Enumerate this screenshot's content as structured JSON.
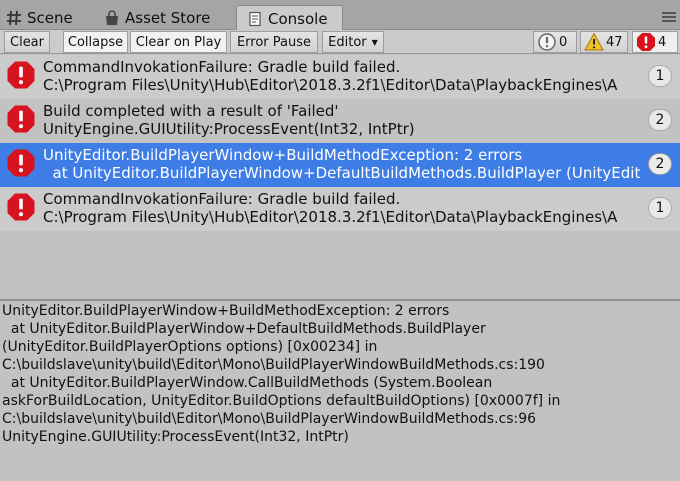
{
  "tabs": [
    {
      "label": "Scene",
      "icon": "scene-hash-icon"
    },
    {
      "label": "Asset Store",
      "icon": "asset-store-icon"
    },
    {
      "label": "Console",
      "icon": "console-document-icon",
      "active": true
    }
  ],
  "toolbar": {
    "clear": "Clear",
    "collapse": "Collapse",
    "clear_on_play": "Clear on Play",
    "error_pause": "Error Pause",
    "editor": "Editor",
    "info_count": "0",
    "warning_count": "47",
    "error_count": "4"
  },
  "colors": {
    "error_red": "#d7131f",
    "selection_blue": "#3e7ce6",
    "warning_yellow": "#f2c12e"
  },
  "entries": [
    {
      "line1": "CommandInvokationFailure: Gradle build failed.",
      "line2": "C:\\Program Files\\Unity\\Hub\\Editor\\2018.3.2f1\\Editor\\Data\\PlaybackEngines\\A",
      "count": "1"
    },
    {
      "line1": "Build completed with a result of 'Failed'",
      "line2": "UnityEngine.GUIUtility:ProcessEvent(Int32, IntPtr)",
      "count": "2"
    },
    {
      "line1": "UnityEditor.BuildPlayerWindow+BuildMethodException: 2 errors",
      "line2": "  at UnityEditor.BuildPlayerWindow+DefaultBuildMethods.BuildPlayer (UnityEdit",
      "count": "2",
      "selected": true
    },
    {
      "line1": "CommandInvokationFailure: Gradle build failed.",
      "line2": "C:\\Program Files\\Unity\\Hub\\Editor\\2018.3.2f1\\Editor\\Data\\PlaybackEngines\\A",
      "count": "1"
    }
  ],
  "detail_lines": [
    "UnityEditor.BuildPlayerWindow+BuildMethodException: 2 errors",
    "  at UnityEditor.BuildPlayerWindow+DefaultBuildMethods.BuildPlayer",
    "(UnityEditor.BuildPlayerOptions options) [0x00234] in",
    "C:\\buildslave\\unity\\build\\Editor\\Mono\\BuildPlayerWindowBuildMethods.cs:190",
    "  at UnityEditor.BuildPlayerWindow.CallBuildMethods (System.Boolean",
    "askForBuildLocation, UnityEditor.BuildOptions defaultBuildOptions) [0x0007f] in",
    "C:\\buildslave\\unity\\build\\Editor\\Mono\\BuildPlayerWindowBuildMethods.cs:96",
    "UnityEngine.GUIUtility:ProcessEvent(Int32, IntPtr)"
  ]
}
